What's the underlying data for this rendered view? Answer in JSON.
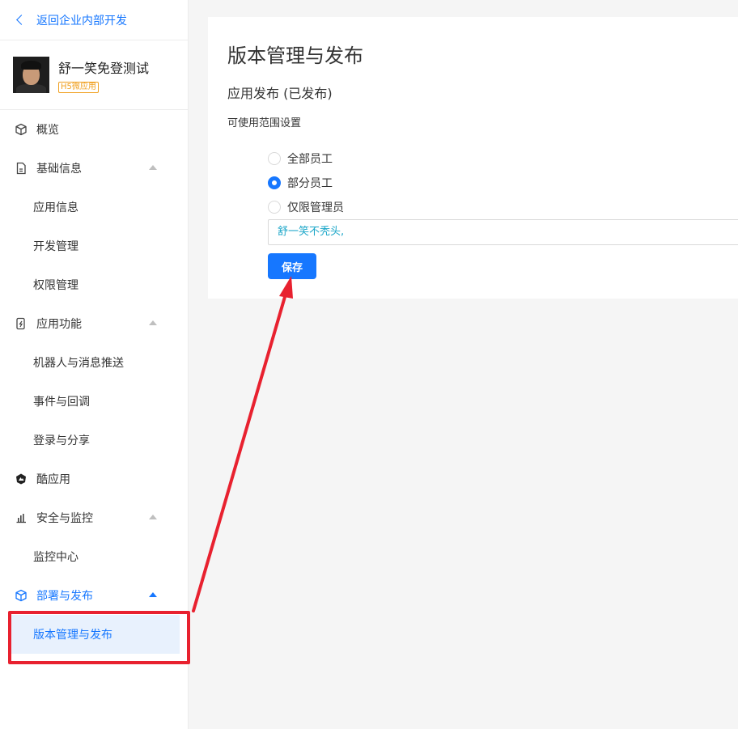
{
  "sidebar": {
    "back_label": "返回企业内部开发",
    "app_name": "舒一笑免登测试",
    "app_tag": "H5微应用",
    "items": [
      {
        "label": "概览",
        "icon": "cube-icon"
      },
      {
        "label": "基础信息",
        "icon": "document-icon"
      },
      {
        "label": "应用信息"
      },
      {
        "label": "开发管理"
      },
      {
        "label": "权限管理"
      },
      {
        "label": "应用功能",
        "icon": "phone-lightning-icon"
      },
      {
        "label": "机器人与消息推送"
      },
      {
        "label": "事件与回调"
      },
      {
        "label": "登录与分享"
      },
      {
        "label": "酷应用",
        "icon": "cool-app-icon"
      },
      {
        "label": "安全与监控",
        "icon": "bar-chart-icon"
      },
      {
        "label": "监控中心"
      },
      {
        "label": "部署与发布",
        "icon": "cube-icon"
      },
      {
        "label": "版本管理与发布"
      }
    ]
  },
  "main": {
    "page_title": "版本管理与发布",
    "section_title": "应用发布 (已发布)",
    "range_label": "可使用范围设置",
    "radio_options": [
      "全部员工",
      "部分员工",
      "仅限管理员"
    ],
    "selected_option": "部分员工",
    "member_value": "舒一笑不秃头,",
    "save_label": "保存"
  },
  "colors": {
    "accent": "#1677ff",
    "annotation": "#e8212f",
    "tag": "#f0a020"
  }
}
